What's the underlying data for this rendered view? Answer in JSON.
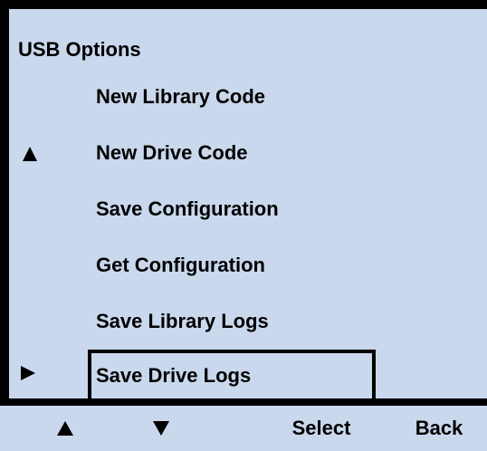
{
  "screen": {
    "title": "USB Options",
    "menu": [
      {
        "label": "New Library Code"
      },
      {
        "label": "New Drive Code"
      },
      {
        "label": "Save Configuration"
      },
      {
        "label": "Get Configuration"
      },
      {
        "label": "Save Library Logs"
      },
      {
        "label": "Save Drive Logs"
      }
    ],
    "selected_item": "Save Drive Logs",
    "icons": {
      "scroll_indicator": "up-triangle-icon",
      "selection_pointer": "right-triangle-icon"
    }
  },
  "softkeys": {
    "up": "up-arrow-icon",
    "down": "down-arrow-icon",
    "select_label": "Select",
    "back_label": "Back"
  },
  "colors": {
    "panel": "#c9d8ec",
    "border": "#000000",
    "text": "#000000"
  }
}
